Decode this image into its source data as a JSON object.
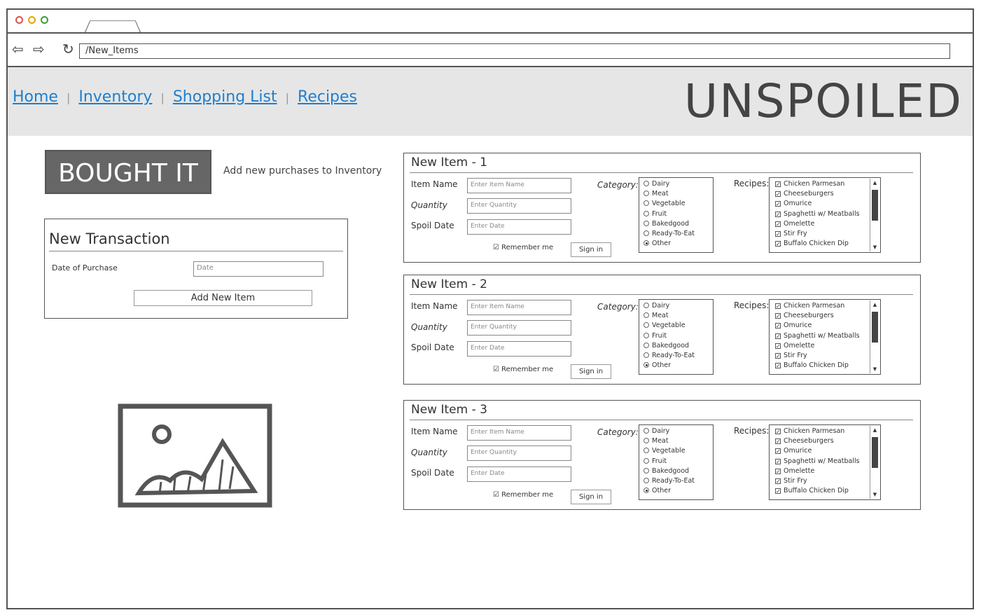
{
  "url": "/New_Items",
  "nav": {
    "home": "Home",
    "inventory": "Inventory",
    "shopping_list": "Shopping List",
    "recipes": "Recipes",
    "sep": "|"
  },
  "logo": "UNSPOILED",
  "hero": {
    "button": "BOUGHT IT",
    "subtitle": "Add new purchases to Inventory"
  },
  "transaction": {
    "title": "New Transaction",
    "date_label": "Date of Purchase",
    "date_placeholder": "Date",
    "add_button": "Add New Item"
  },
  "item_form": {
    "name_label": "Item Name",
    "name_placeholder": "Enter Item Name",
    "qty_label": "Quantity",
    "qty_placeholder": "Enter Quantity",
    "spoil_label": "Spoil Date",
    "spoil_placeholder": "Enter Date",
    "remember": "Remember me",
    "signin": "Sign in",
    "category_label": "Category:",
    "categories": [
      "Dairy",
      "Meat",
      "Vegetable",
      "Fruit",
      "Bakedgood",
      "Ready-To-Eat",
      "Other"
    ],
    "selected_category": "Other",
    "recipes_label": "Recipes:",
    "recipes": [
      "Chicken Parmesan",
      "Cheeseburgers",
      "Omurice",
      "Spaghetti w/ Meatballs",
      "Omelette",
      "Stir Fry",
      "Buffalo Chicken Dip"
    ]
  },
  "items": [
    {
      "title": "New Item - 1"
    },
    {
      "title": "New Item - 2"
    },
    {
      "title": "New Item - 3"
    }
  ]
}
